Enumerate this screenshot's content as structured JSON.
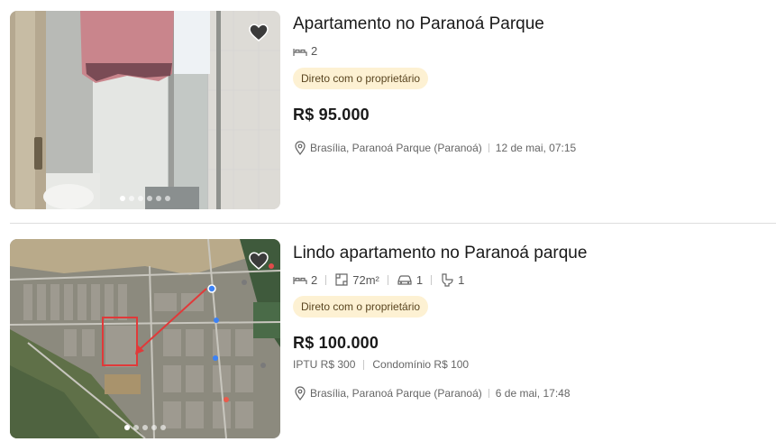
{
  "listings": [
    {
      "title": "Apartamento no Paranoá Parque",
      "features": {
        "bedrooms": "2"
      },
      "badge": "Direto com o proprietário",
      "price": "R$ 95.000",
      "location": "Brasília, Paranoá Parque (Paranoá)",
      "date": "12 de mai, 07:15",
      "photo_dots": 6,
      "photo_active_dot": 1
    },
    {
      "title": "Lindo apartamento no Paranoá parque",
      "features": {
        "bedrooms": "2",
        "area": "72m²",
        "parking": "1",
        "bathrooms": "1"
      },
      "badge": "Direto com o proprietário",
      "price": "R$ 100.000",
      "iptu": "IPTU R$ 300",
      "condominio": "Condomínio R$ 100",
      "location": "Brasília, Paranoá Parque (Paranoá)",
      "date": "6 de mai, 17:48",
      "photo_dots": 5,
      "photo_active_dot": 1
    }
  ],
  "icons": {
    "favorite": "heart-icon",
    "bed": "bed-icon",
    "area": "area-icon",
    "parking": "car-icon",
    "bathroom": "toilet-icon",
    "location": "location-pin-icon"
  },
  "colors": {
    "badge_bg": "#fdf1d3",
    "badge_text": "#5a4520",
    "text_muted": "#666666"
  }
}
